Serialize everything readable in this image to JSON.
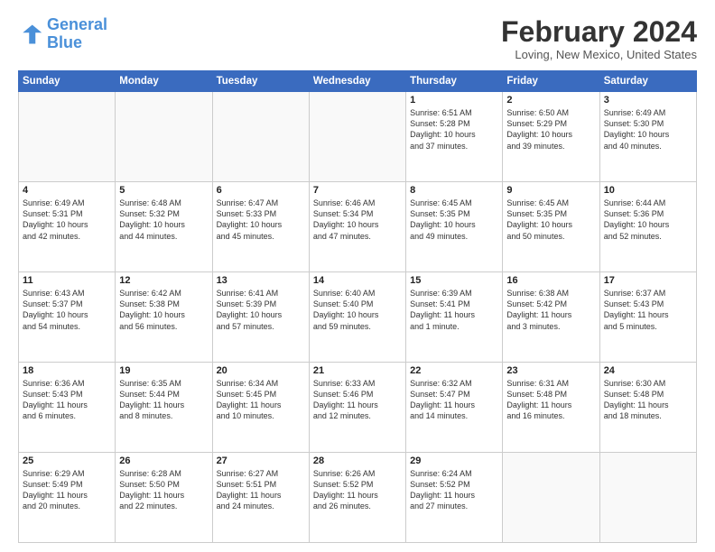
{
  "header": {
    "logo_line1": "General",
    "logo_line2": "Blue",
    "month_title": "February 2024",
    "location": "Loving, New Mexico, United States"
  },
  "weekdays": [
    "Sunday",
    "Monday",
    "Tuesday",
    "Wednesday",
    "Thursday",
    "Friday",
    "Saturday"
  ],
  "weeks": [
    [
      {
        "day": "",
        "info": ""
      },
      {
        "day": "",
        "info": ""
      },
      {
        "day": "",
        "info": ""
      },
      {
        "day": "",
        "info": ""
      },
      {
        "day": "1",
        "info": "Sunrise: 6:51 AM\nSunset: 5:28 PM\nDaylight: 10 hours\nand 37 minutes."
      },
      {
        "day": "2",
        "info": "Sunrise: 6:50 AM\nSunset: 5:29 PM\nDaylight: 10 hours\nand 39 minutes."
      },
      {
        "day": "3",
        "info": "Sunrise: 6:49 AM\nSunset: 5:30 PM\nDaylight: 10 hours\nand 40 minutes."
      }
    ],
    [
      {
        "day": "4",
        "info": "Sunrise: 6:49 AM\nSunset: 5:31 PM\nDaylight: 10 hours\nand 42 minutes."
      },
      {
        "day": "5",
        "info": "Sunrise: 6:48 AM\nSunset: 5:32 PM\nDaylight: 10 hours\nand 44 minutes."
      },
      {
        "day": "6",
        "info": "Sunrise: 6:47 AM\nSunset: 5:33 PM\nDaylight: 10 hours\nand 45 minutes."
      },
      {
        "day": "7",
        "info": "Sunrise: 6:46 AM\nSunset: 5:34 PM\nDaylight: 10 hours\nand 47 minutes."
      },
      {
        "day": "8",
        "info": "Sunrise: 6:45 AM\nSunset: 5:35 PM\nDaylight: 10 hours\nand 49 minutes."
      },
      {
        "day": "9",
        "info": "Sunrise: 6:45 AM\nSunset: 5:35 PM\nDaylight: 10 hours\nand 50 minutes."
      },
      {
        "day": "10",
        "info": "Sunrise: 6:44 AM\nSunset: 5:36 PM\nDaylight: 10 hours\nand 52 minutes."
      }
    ],
    [
      {
        "day": "11",
        "info": "Sunrise: 6:43 AM\nSunset: 5:37 PM\nDaylight: 10 hours\nand 54 minutes."
      },
      {
        "day": "12",
        "info": "Sunrise: 6:42 AM\nSunset: 5:38 PM\nDaylight: 10 hours\nand 56 minutes."
      },
      {
        "day": "13",
        "info": "Sunrise: 6:41 AM\nSunset: 5:39 PM\nDaylight: 10 hours\nand 57 minutes."
      },
      {
        "day": "14",
        "info": "Sunrise: 6:40 AM\nSunset: 5:40 PM\nDaylight: 10 hours\nand 59 minutes."
      },
      {
        "day": "15",
        "info": "Sunrise: 6:39 AM\nSunset: 5:41 PM\nDaylight: 11 hours\nand 1 minute."
      },
      {
        "day": "16",
        "info": "Sunrise: 6:38 AM\nSunset: 5:42 PM\nDaylight: 11 hours\nand 3 minutes."
      },
      {
        "day": "17",
        "info": "Sunrise: 6:37 AM\nSunset: 5:43 PM\nDaylight: 11 hours\nand 5 minutes."
      }
    ],
    [
      {
        "day": "18",
        "info": "Sunrise: 6:36 AM\nSunset: 5:43 PM\nDaylight: 11 hours\nand 6 minutes."
      },
      {
        "day": "19",
        "info": "Sunrise: 6:35 AM\nSunset: 5:44 PM\nDaylight: 11 hours\nand 8 minutes."
      },
      {
        "day": "20",
        "info": "Sunrise: 6:34 AM\nSunset: 5:45 PM\nDaylight: 11 hours\nand 10 minutes."
      },
      {
        "day": "21",
        "info": "Sunrise: 6:33 AM\nSunset: 5:46 PM\nDaylight: 11 hours\nand 12 minutes."
      },
      {
        "day": "22",
        "info": "Sunrise: 6:32 AM\nSunset: 5:47 PM\nDaylight: 11 hours\nand 14 minutes."
      },
      {
        "day": "23",
        "info": "Sunrise: 6:31 AM\nSunset: 5:48 PM\nDaylight: 11 hours\nand 16 minutes."
      },
      {
        "day": "24",
        "info": "Sunrise: 6:30 AM\nSunset: 5:48 PM\nDaylight: 11 hours\nand 18 minutes."
      }
    ],
    [
      {
        "day": "25",
        "info": "Sunrise: 6:29 AM\nSunset: 5:49 PM\nDaylight: 11 hours\nand 20 minutes."
      },
      {
        "day": "26",
        "info": "Sunrise: 6:28 AM\nSunset: 5:50 PM\nDaylight: 11 hours\nand 22 minutes."
      },
      {
        "day": "27",
        "info": "Sunrise: 6:27 AM\nSunset: 5:51 PM\nDaylight: 11 hours\nand 24 minutes."
      },
      {
        "day": "28",
        "info": "Sunrise: 6:26 AM\nSunset: 5:52 PM\nDaylight: 11 hours\nand 26 minutes."
      },
      {
        "day": "29",
        "info": "Sunrise: 6:24 AM\nSunset: 5:52 PM\nDaylight: 11 hours\nand 27 minutes."
      },
      {
        "day": "",
        "info": ""
      },
      {
        "day": "",
        "info": ""
      }
    ]
  ]
}
